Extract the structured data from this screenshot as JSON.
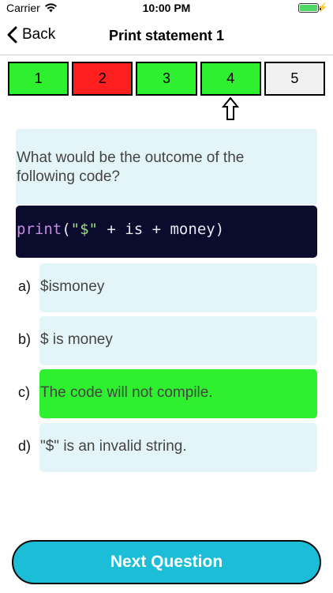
{
  "status_bar": {
    "carrier": "Carrier",
    "time": "10:00 PM",
    "battery_level": 1.0,
    "battery_color": "#4cd964",
    "icons": [
      "wifi-icon",
      "battery-icon",
      "charging-bolt-icon"
    ]
  },
  "nav": {
    "back_label": "Back",
    "back_icon": "chevron-left-icon",
    "title": "Print statement 1"
  },
  "questions_progress": [
    {
      "label": "1",
      "state": "correct",
      "color": "#2ef02e"
    },
    {
      "label": "2",
      "state": "incorrect",
      "color": "#ff1f1f"
    },
    {
      "label": "3",
      "state": "correct",
      "color": "#2ef02e"
    },
    {
      "label": "4",
      "state": "current-correct",
      "color": "#2ef02e"
    },
    {
      "label": "5",
      "state": "unanswered",
      "color": "#f0f0f0"
    }
  ],
  "current_indicator_icon": "up-arrow-icon",
  "question": {
    "text": "What would be the outcome of the following code?",
    "code": {
      "fn": "print",
      "open": "(",
      "string": "\"$\"",
      "rest": " + is + money)"
    }
  },
  "answers": [
    {
      "letter": "a)",
      "text": "$ismoney",
      "state": "normal"
    },
    {
      "letter": "b)",
      "text": "$ is money",
      "state": "normal"
    },
    {
      "letter": "c)",
      "text": "The code will not compile.",
      "state": "correct"
    },
    {
      "letter": "d)",
      "text": "\"$\" is an invalid string.",
      "state": "normal"
    }
  ],
  "colors": {
    "card_bg": "#e3f5f8",
    "correct": "#2ef02e",
    "incorrect": "#ff1f1f",
    "code_bg": "#0b0b2e",
    "button_bg": "#1cbdd6"
  },
  "next_button": {
    "label": "Next Question"
  }
}
